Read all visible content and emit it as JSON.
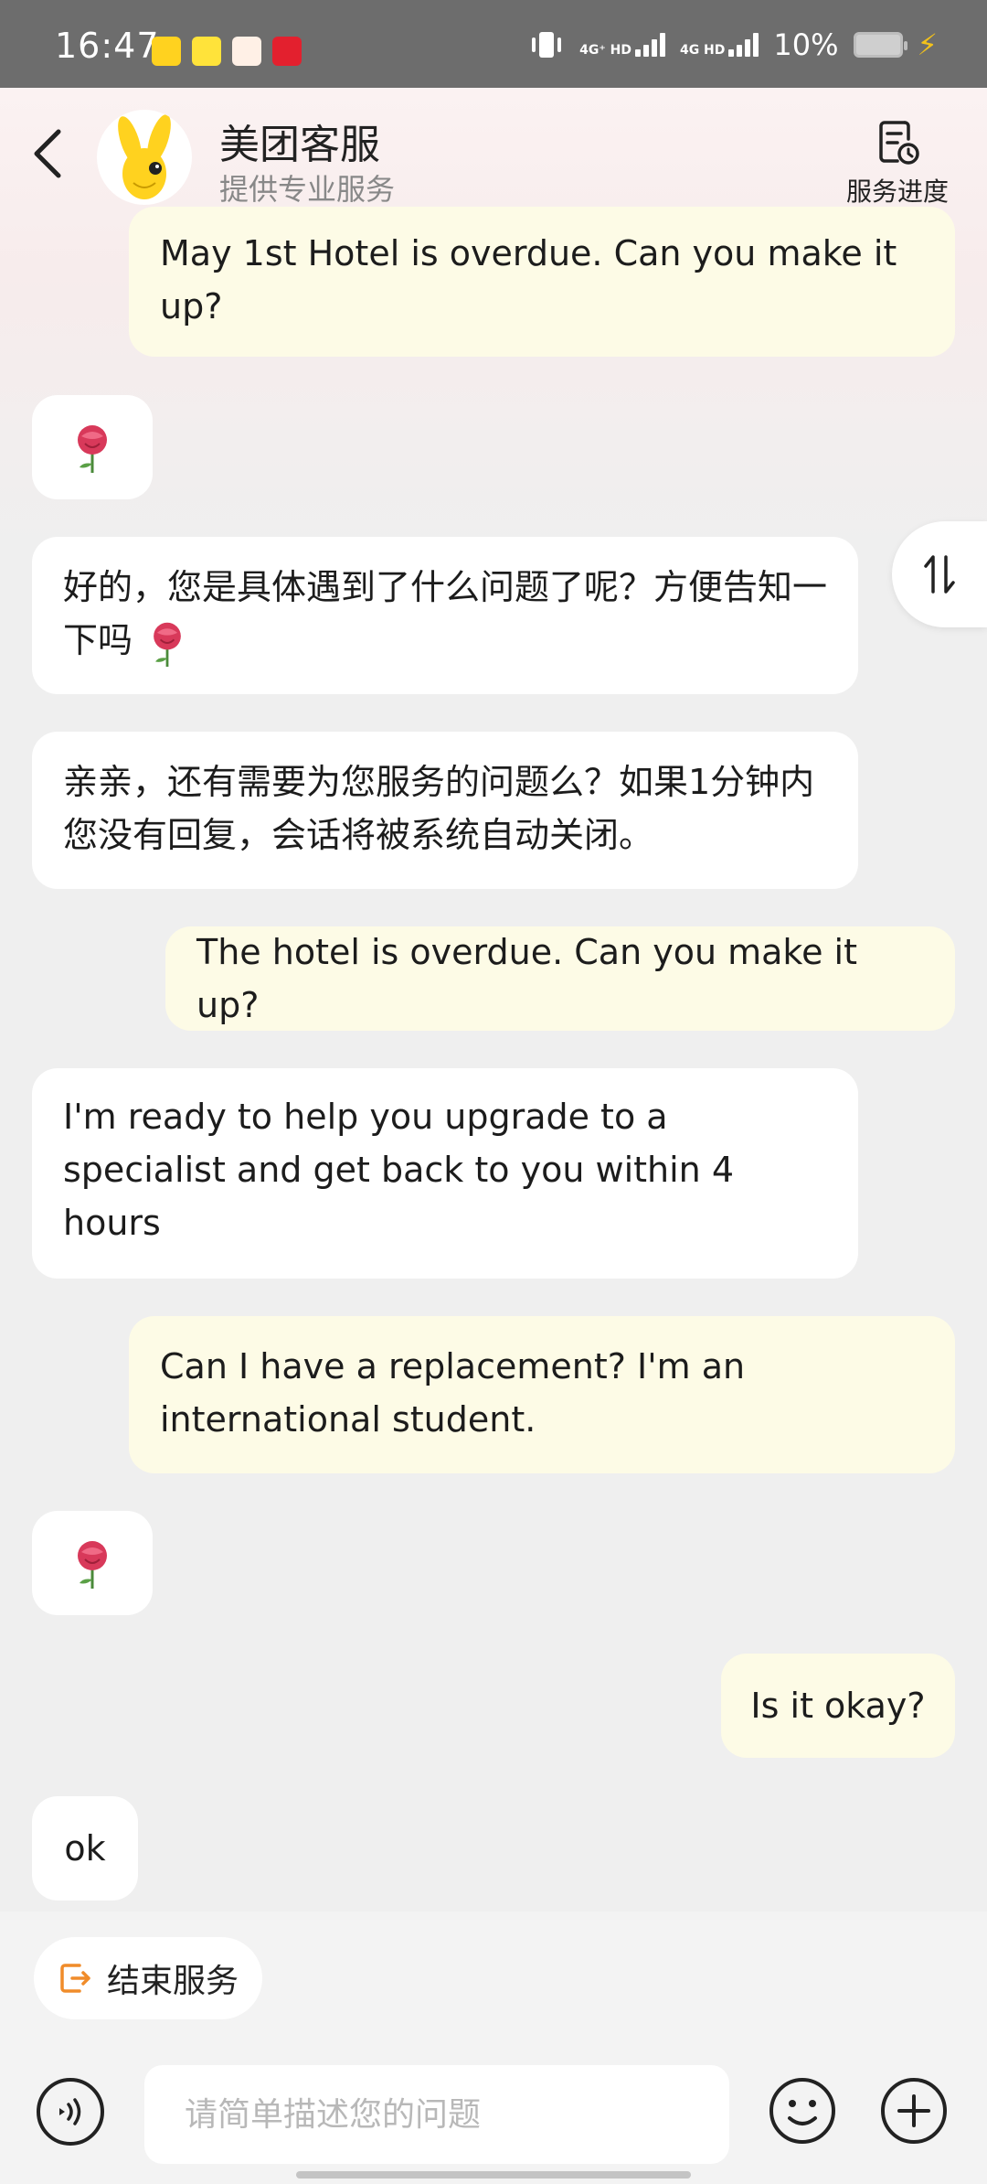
{
  "status_bar": {
    "time": "16:47",
    "notifications": [
      "美团",
      "闲鱼",
      "淘宝",
      "天猫"
    ],
    "network1": "4G⁺ HD",
    "network2": "4G HD",
    "battery": "10%"
  },
  "header": {
    "title": "美团客服",
    "subtitle": "提供专业服务",
    "progress_label": "服务进度"
  },
  "messages": [
    {
      "role": "user",
      "text": "May 1st Hotel is overdue. Can you make it up?"
    },
    {
      "role": "agent",
      "text": "",
      "emoji": "rose"
    },
    {
      "role": "agent",
      "text": "好的，您是具体遇到了什么问题了呢？方便告知一下吗",
      "emoji": "rose"
    },
    {
      "role": "agent",
      "text": "亲亲，还有需要为您服务的问题么？如果1分钟内您没有回复，会话将被系统自动关闭。"
    },
    {
      "role": "user",
      "text": "The hotel is overdue. Can you make it up?"
    },
    {
      "role": "agent",
      "text": "I'm ready to help you upgrade to a specialist and get back to you within 4 hours"
    },
    {
      "role": "user",
      "text": "Can I have a replacement? I'm an international student."
    },
    {
      "role": "agent",
      "text": "",
      "emoji": "rose"
    },
    {
      "role": "user",
      "text": "Is it okay?"
    },
    {
      "role": "agent",
      "text": "ok"
    }
  ],
  "bottom": {
    "end_service_label": "结束服务",
    "input_placeholder": "请简单描述您的问题"
  },
  "colors": {
    "agent_bubble": "#ffffff",
    "user_bubble": "#fdfbe6",
    "accent_orange": "#f08c2a"
  }
}
